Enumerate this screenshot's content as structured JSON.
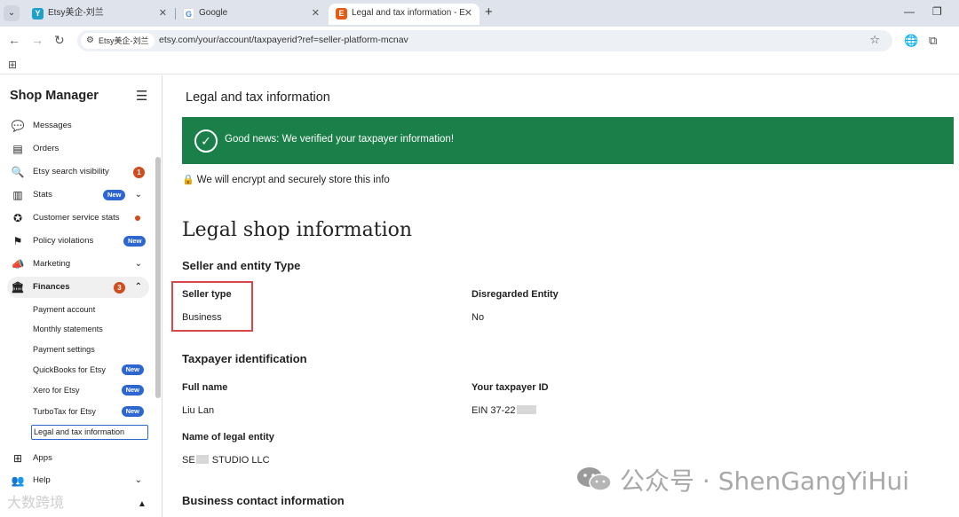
{
  "browser": {
    "tabs": [
      {
        "title": "Etsy美企-刘兰",
        "favicon": "Y",
        "color": "#1da1c9"
      },
      {
        "title": "Google",
        "favicon": "G",
        "color": "#4285f4"
      },
      {
        "title": "Legal and tax information - E",
        "favicon": "E",
        "color": "#e55b13"
      }
    ],
    "new_tab": "+",
    "site_chip": "Etsy美企-刘兰",
    "url": "etsy.com/your/account/taxpayerid?ref=seller-platform-mcnav"
  },
  "sidebar": {
    "title": "Shop Manager",
    "items": [
      {
        "label": "Messages",
        "icon": "chat-icon"
      },
      {
        "label": "Orders",
        "icon": "orders-icon"
      },
      {
        "label": "Etsy search visibility",
        "icon": "search-icon",
        "badge": "1"
      },
      {
        "label": "Stats",
        "icon": "stats-icon",
        "tag": "New"
      },
      {
        "label": "Customer service stats",
        "icon": "star-icon"
      },
      {
        "label": "Policy violations",
        "icon": "flag-icon",
        "tag": "New"
      },
      {
        "label": "Marketing",
        "icon": "megaphone-icon"
      },
      {
        "label": "Finances",
        "icon": "bank-icon",
        "badge": "3"
      }
    ],
    "finance_sub": [
      {
        "label": "Payment account"
      },
      {
        "label": "Monthly statements"
      },
      {
        "label": "Payment settings"
      },
      {
        "label": "QuickBooks for Etsy",
        "tag": "New"
      },
      {
        "label": "Xero for Etsy",
        "tag": "New"
      },
      {
        "label": "TurboTax for Etsy",
        "tag": "New"
      },
      {
        "label": "Legal and tax information"
      }
    ],
    "bottom": [
      {
        "label": "Apps",
        "icon": "apps-icon"
      },
      {
        "label": "Help",
        "icon": "help-icon"
      }
    ]
  },
  "main": {
    "title": "Legal and tax information",
    "banner": "Good news: We verified your taxpayer information!",
    "encrypt_note": "We will encrypt and securely store this info",
    "legal_heading": "Legal shop information",
    "seller_section": "Seller and entity Type",
    "seller_type_label": "Seller type",
    "seller_type_value": "Business",
    "disregarded_label": "Disregarded Entity",
    "disregarded_value": "No",
    "taxpayer_section": "Taxpayer identification",
    "full_name_label": "Full name",
    "full_name_value": "Liu Lan",
    "taxpayer_id_label": "Your taxpayer ID",
    "taxpayer_id_prefix": "EIN 37-22",
    "legal_entity_label": "Name of legal entity",
    "legal_entity_prefix": "SE",
    "legal_entity_suffix": "STUDIO LLC",
    "contact_section": "Business contact information"
  },
  "watermark": {
    "text": "公众号 · ShenGangYiHui",
    "corner": "大数跨境"
  },
  "colors": {
    "banner": "#1a7f49",
    "new_tag": "#2e66d1",
    "alert": "#d14b1f",
    "highlight": "#d9474a"
  }
}
